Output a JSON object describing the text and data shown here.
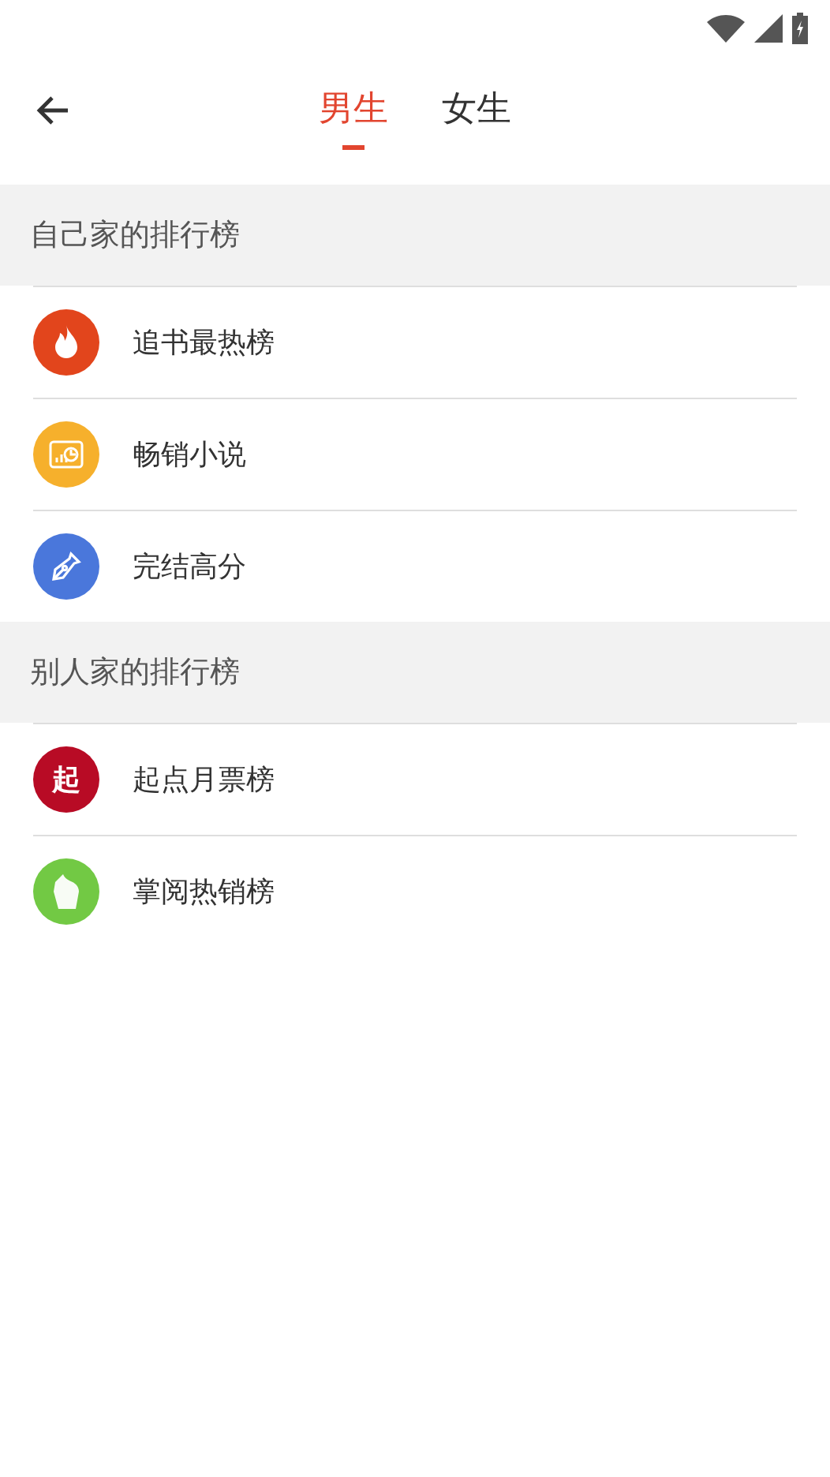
{
  "tabs": [
    {
      "label": "男生",
      "selected": true
    },
    {
      "label": "女生",
      "selected": false
    }
  ],
  "sections": [
    {
      "title": "自己家的排行榜",
      "items": [
        {
          "label": "追书最热榜",
          "kind": "flame",
          "color": "#e2451c"
        },
        {
          "label": "畅销小说",
          "kind": "chart",
          "color": "#f6b02c"
        },
        {
          "label": "完结高分",
          "kind": "pen",
          "color": "#4a77db"
        }
      ]
    },
    {
      "title": "别人家的排行榜",
      "items": [
        {
          "label": "起点月票榜",
          "kind": "glyph",
          "glyph": "起",
          "color": "#b80b25"
        },
        {
          "label": "掌阅热销榜",
          "kind": "leaf",
          "color": "#72c944"
        }
      ]
    }
  ]
}
